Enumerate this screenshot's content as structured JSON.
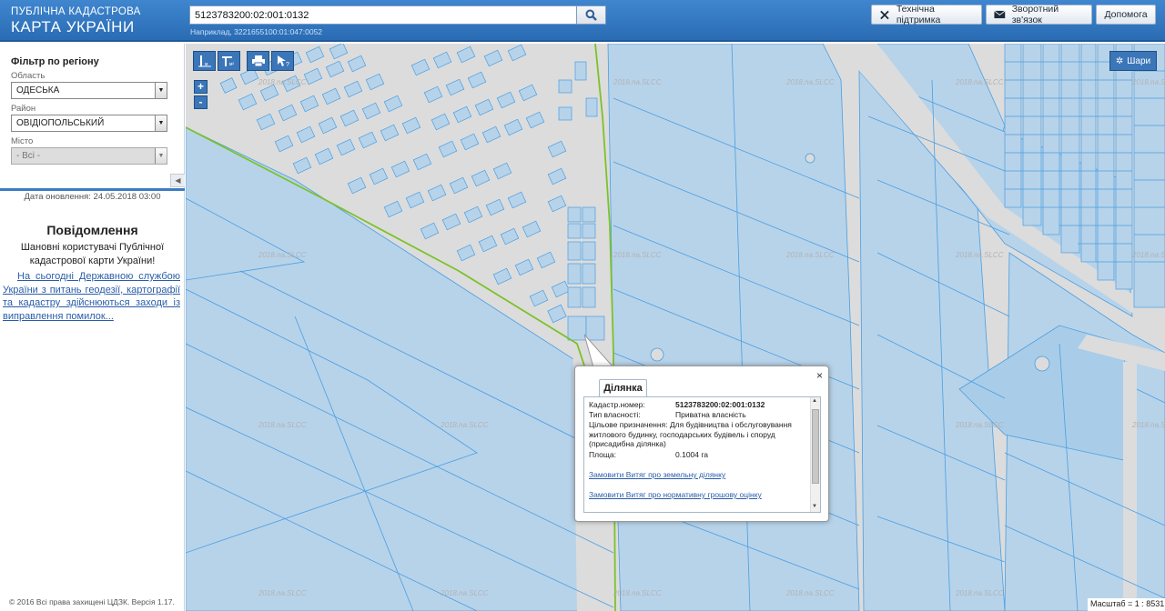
{
  "header": {
    "logo_line1": "ПУБЛІЧНА КАДАСТРОВА",
    "logo_line2": "КАРТА УКРАЇНИ",
    "search_value": "5123783200:02:001:0132",
    "search_hint": "Наприклад, 3221655100:01:047:0052",
    "buttons": {
      "support": "Технічна підтримка",
      "feedback": "Зворотний зв'язок",
      "help": "Допомога"
    }
  },
  "sidebar": {
    "filter_title": "Фільтр по регіону",
    "region_label": "Область",
    "region_value": "ОДЕСЬКА",
    "district_label": "Район",
    "district_value": "ОВІДІОПОЛЬСЬКИЙ",
    "city_label": "Місто",
    "city_value": "- Всі -",
    "update_date": "Дата оновлення: 24.05.2018 03:00",
    "notice_title": "Повідомлення",
    "notice_text": "Шановні користувачі Публічної кадастрової карти України!",
    "notice_link": "На сьогодні Державною службою України з питань геодезії, картографії та кадастру здійснюються заходи із виправлення помилок...",
    "footer": "© 2016 Всі права захищені ЦДЗК. Версія 1.17."
  },
  "map": {
    "layers_label": "Шари",
    "zoom_in": "+",
    "zoom_out": "-",
    "scale_text": "Масштаб = 1 : 8531",
    "watermark": "2018.na.SLCC",
    "colors": {
      "parcel_fill": "#b7d3ea",
      "parcel_stroke": "#4a9ee0",
      "road": "#dcdcdc",
      "boundary": "#7cc22a"
    }
  },
  "popup": {
    "tab_label": "Ділянка",
    "close": "×",
    "rows": [
      {
        "key": "Кадастр.номер:",
        "value": "5123783200:02:001:0132",
        "bold": true
      },
      {
        "key": "Тип власності:",
        "value": "Приватна власність"
      },
      {
        "key": "Цільове призначення:",
        "value": "Для будівництва і обслуговування житлового будинку, господарських будівель і споруд (присадибна ділянка)"
      },
      {
        "key": "Площа:",
        "value": "0.1004 га"
      }
    ],
    "link1": "Замовити Витяг про земельну ділянку",
    "link2": "Замовити Витяг про нормативну грошову оцінку"
  }
}
